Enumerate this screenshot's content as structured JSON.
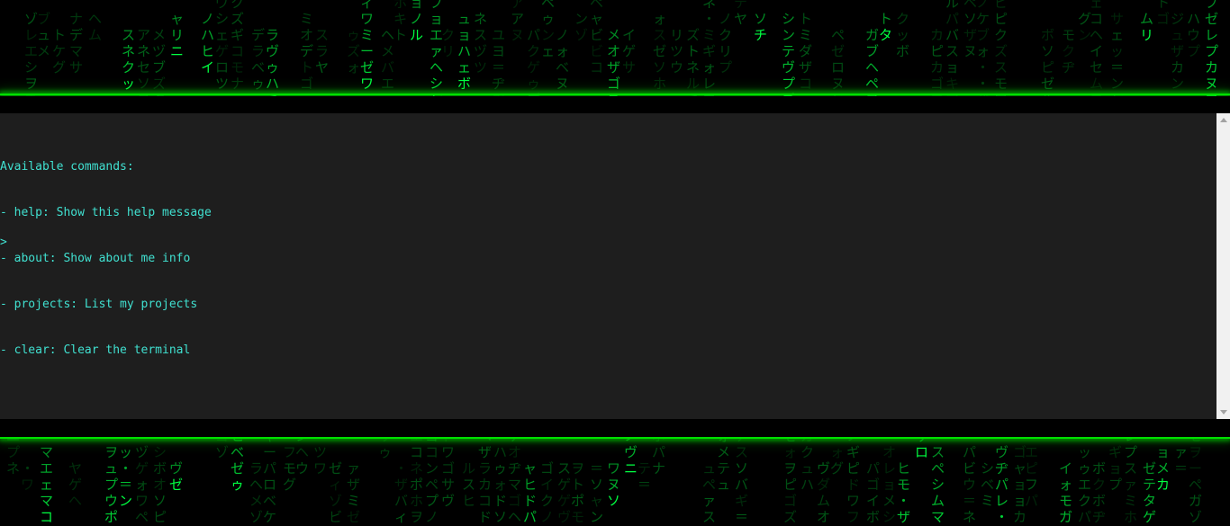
{
  "theme": {
    "rain_color": "#00ff41",
    "terminal_bg": "#1e1e1e",
    "terminal_text": "#40e0d0",
    "glow_line": "#00e000"
  },
  "terminal": {
    "output_lines": [
      "Available commands:",
      "- help: Show this help message",
      "- about: Show about me info",
      "- projects: List my projects",
      "- clear: Clear the terminal"
    ],
    "prompt_symbol": ">",
    "input_value": ""
  },
  "icons": {
    "scroll_up": "scroll-up-arrow-icon",
    "scroll_down": "scroll-down-arrow-icon"
  }
}
